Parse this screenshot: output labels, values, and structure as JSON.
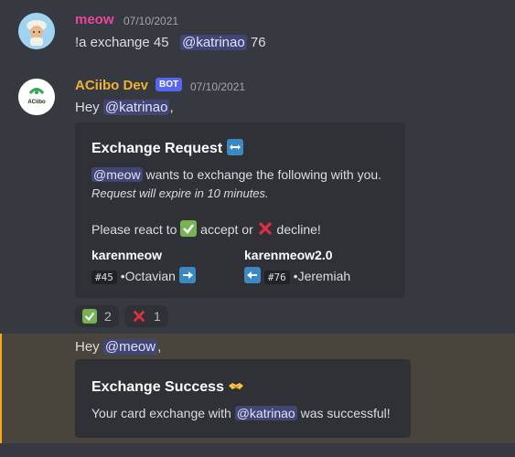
{
  "messages": [
    {
      "username": "meow",
      "username_color": "#eb459e",
      "timestamp": "07/10/2021",
      "text_prefix": "!a exchange 45",
      "mention": "@katrinao",
      "text_suffix": "76"
    },
    {
      "username": "ACiibo Dev",
      "username_color": "#f0b232",
      "bot_tag": "BOT",
      "timestamp": "07/10/2021",
      "avatar_label": "ACiibo",
      "greeting": "Hey",
      "mention": "@katrinao",
      "greeting_suffix": ",",
      "embed": {
        "title": "Exchange Request",
        "title_icon": "left-right-arrow-icon",
        "line1_mention": "@meow",
        "line1_text": "wants to exchange the following with you.",
        "line2_italic": "Request will expire in 10 minutes.",
        "react_prefix": "Please react to",
        "accept_text": "accept or",
        "decline_text": "decline!",
        "left": {
          "name": "karenmeow",
          "badge": "#45",
          "item": "Octavian"
        },
        "right": {
          "name": "karenmeow2.0",
          "badge": "#76",
          "item": "Jeremiah"
        }
      },
      "reactions": [
        {
          "emoji": "check-mark-icon",
          "count": "2"
        },
        {
          "emoji": "cross-mark-icon",
          "count": "1"
        }
      ]
    },
    {
      "greeting": "Hey",
      "mention": "@meow",
      "greeting_suffix": ",",
      "embed": {
        "title": "Exchange Success",
        "title_icon": "handshake-icon",
        "body_prefix": "Your card exchange with",
        "body_mention": "@katrinao",
        "body_suffix": "was successful!"
      }
    }
  ],
  "colors": {
    "background": "#36393f",
    "embed_bg": "#2f3136",
    "highlight_bg": "#49443c",
    "highlight_bar": "#faa81a",
    "mention_bg": "#414675"
  }
}
